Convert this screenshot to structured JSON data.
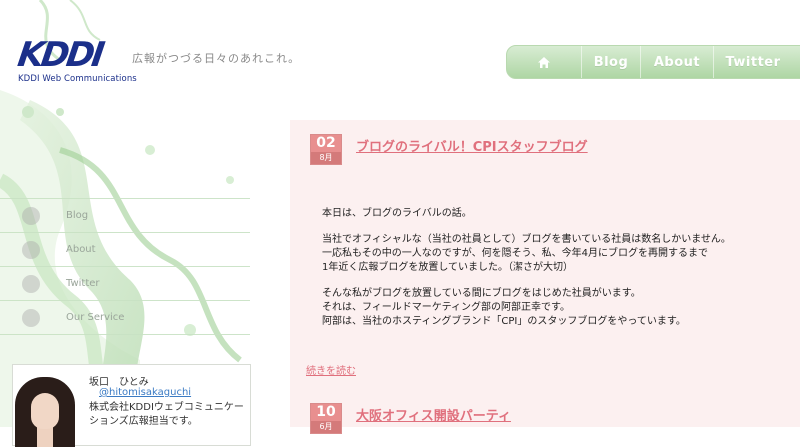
{
  "header": {
    "logo": "KDDI",
    "logo_sub": "KDDI Web Communications",
    "tagline": "広報がつづる日々のあれこれ。"
  },
  "topnav": {
    "home_icon": "home-icon",
    "items": [
      "Blog",
      "About",
      "Twitter"
    ]
  },
  "sidenav": {
    "items": [
      {
        "label": "Blog",
        "icon": "blog-icon"
      },
      {
        "label": "About",
        "icon": "person-icon"
      },
      {
        "label": "Twitter",
        "icon": "speech-bubble-icon"
      },
      {
        "label": "Our Service",
        "icon": "gear-icon"
      }
    ]
  },
  "profile": {
    "name": "坂口　ひとみ",
    "handle": "@hitomisakaguchi",
    "desc": "株式会社KDDIウェブコミュニケーションズ広報担当です。"
  },
  "posts": [
    {
      "day": "02",
      "month": "8月",
      "title": "ブログのライバル！CPIスタッフブログ",
      "paragraphs": [
        [
          "本日は、ブログのライバルの話。"
        ],
        [
          "当社でオフィシャルな（当社の社員として）ブログを書いている社員は数名しかいません。",
          "一応私もその中の一人なのですが、何を隠そう、私、今年4月にブログを再開するまで",
          "1年近く広報ブログを放置していました。（潔さが大切）"
        ],
        [
          "そんな私がブログを放置している間にブログをはじめた社員がいます。",
          "それは、フィールドマーケティング部の阿部正幸です。",
          "阿部は、当社のホスティングブランド「CPI」のスタッフブログをやっています。"
        ]
      ],
      "read_more": "続きを読む"
    },
    {
      "day": "10",
      "month": "6月",
      "title": "大阪オフィス開設パーティ"
    }
  ],
  "colors": {
    "accent_pink": "#e0707d",
    "nav_green": "#aed6a4",
    "logo_blue": "#1b2f8a"
  }
}
